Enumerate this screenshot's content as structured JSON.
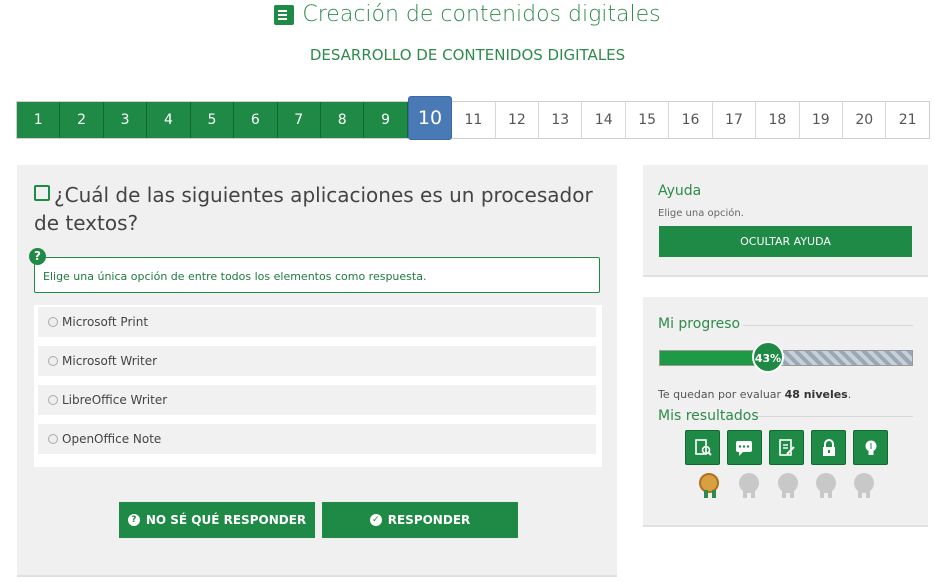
{
  "header": {
    "title": "Creación de contenidos digitales",
    "subtitle": "DESARROLLO DE CONTENIDOS DIGITALES"
  },
  "levels": {
    "items": [
      "1",
      "2",
      "3",
      "4",
      "5",
      "6",
      "7",
      "8",
      "9",
      "10",
      "11",
      "12",
      "13",
      "14",
      "15",
      "16",
      "17",
      "18",
      "19",
      "20",
      "21"
    ],
    "current": "10"
  },
  "question": {
    "text": "¿Cuál de las siguientes aplicaciones es un procesador de textos?",
    "hint_badge": "?",
    "hint": "Elige una única opción de entre todos los elementos como respuesta.",
    "options": [
      "Microsoft Print",
      "Microsoft Writer",
      "LibreOffice Writer",
      "OpenOffice Note"
    ],
    "dont_know_label": "NO SÉ QUÉ RESPONDER",
    "answer_label": "RESPONDER"
  },
  "help": {
    "title": "Ayuda",
    "text": "Elige una opción.",
    "hide_button": "OCULTAR AYUDA"
  },
  "progress": {
    "title": "Mi progreso",
    "percent": 43,
    "percent_label": "43%",
    "remaining_prefix": "Te quedan por evaluar",
    "remaining_value": "48 niveles",
    "remaining_suffix": ".",
    "results_title": "Mis resultados",
    "result_icons": [
      "search-document-icon",
      "chat-icon",
      "edit-document-icon",
      "lock-icon",
      "lightbulb-icon"
    ],
    "medals": [
      "gold",
      "grey",
      "grey",
      "grey",
      "grey"
    ]
  },
  "colors": {
    "primary": "#1e8a45",
    "current_level": "#4a7ab5",
    "panel_bg": "#f0f0f0"
  }
}
